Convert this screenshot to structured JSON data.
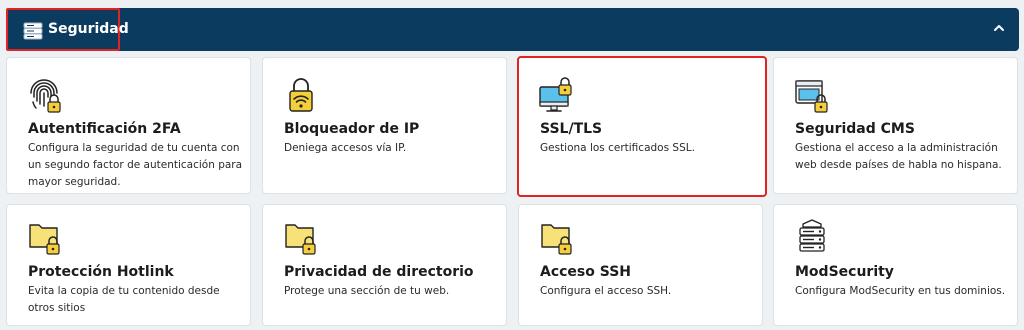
{
  "header": {
    "title": "Seguridad",
    "icon": "server-stack-icon",
    "toggle_icon": "chevron-up-icon"
  },
  "cards": [
    {
      "title": "Autentificación 2FA",
      "description": "Configura la seguridad de tu cuenta con un segundo factor de autenticación para mayor seguridad.",
      "icon": "fingerprint-lock-icon"
    },
    {
      "title": "Bloqueador de IP",
      "description": "Deniega accesos vía IP.",
      "icon": "wifi-lock-icon"
    },
    {
      "title": "SSL/TLS",
      "description": "Gestiona los certificados SSL.",
      "icon": "monitor-lock-icon"
    },
    {
      "title": "Seguridad CMS",
      "description": "Gestiona el acceso a la administración web desde países de habla no hispana.",
      "icon": "browser-lock-icon"
    },
    {
      "title": "Protección Hotlink",
      "description": "Evita la copia de tu contenido desde otros sitios",
      "icon": "folder-lock-icon"
    },
    {
      "title": "Privacidad de directorio",
      "description": "Protege una sección de tu web.",
      "icon": "folder-lock-icon"
    },
    {
      "title": "Acceso SSH",
      "description": "Configura el acceso SSH.",
      "icon": "folder-lock-icon"
    },
    {
      "title": "ModSecurity",
      "description": "Configura ModSecurity en tus dominios.",
      "icon": "server-stack-icon"
    }
  ],
  "colors": {
    "header_bg": "#0c3b60",
    "highlight_border": "#e32222",
    "lock_yellow": "#f5cf3a",
    "folder_yellow": "#f7e27a"
  }
}
